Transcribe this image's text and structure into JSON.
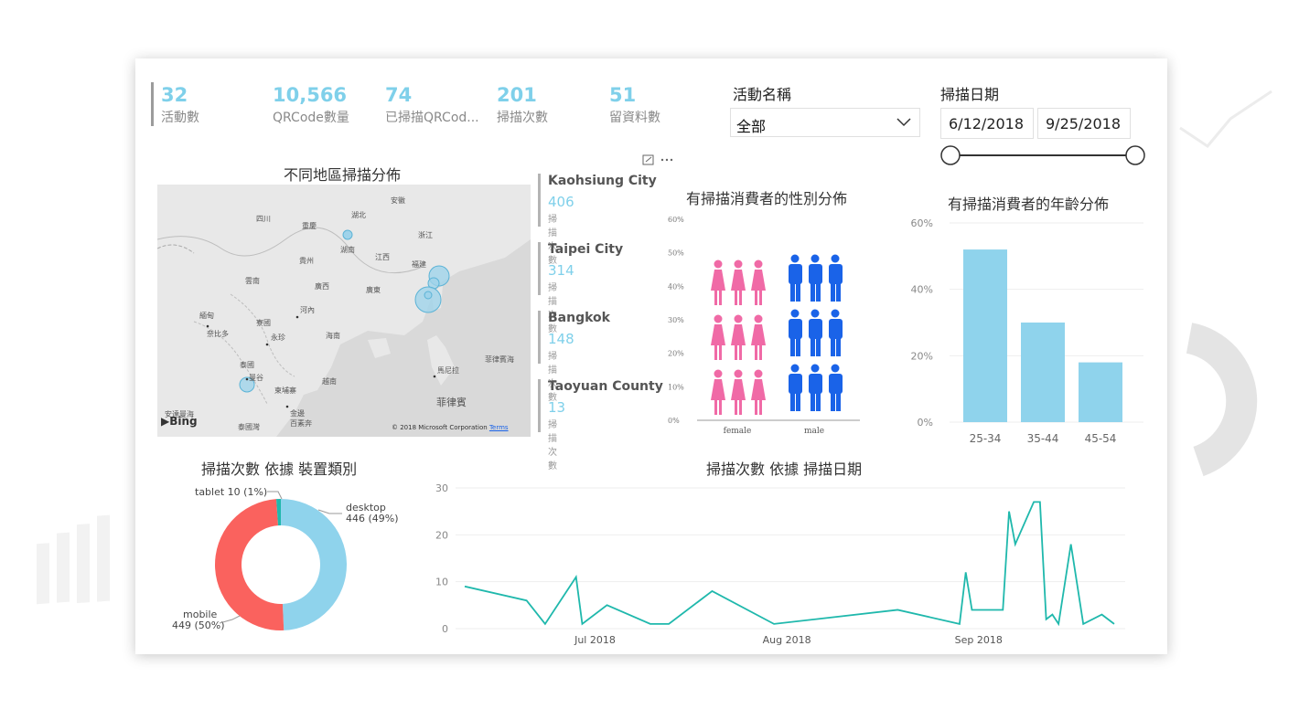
{
  "kpis": [
    {
      "value": "32",
      "label": "活動數"
    },
    {
      "value": "10,566",
      "label": "QRCode數量"
    },
    {
      "value": "74",
      "label": "已掃描QRCod..."
    },
    {
      "value": "201",
      "label": "掃描次數"
    },
    {
      "value": "51",
      "label": "留資料數"
    }
  ],
  "slicers": {
    "activity": {
      "title": "活動名稱",
      "value": "全部"
    },
    "date": {
      "title": "掃描日期",
      "start": "6/12/2018",
      "end": "9/25/2018"
    }
  },
  "map": {
    "title": "不同地區掃描分佈",
    "attribution": "© 2018 Microsoft Corporation",
    "terms": "Terms",
    "bing": "Bing",
    "labels": [
      "四川",
      "湖北",
      "安徽",
      "重慶",
      "湖南",
      "浙江",
      "貴州",
      "江西",
      "福建",
      "雲南",
      "廣西",
      "廣東",
      "緬甸",
      "河內",
      "寮國",
      "奈比多",
      "永珍",
      "海南",
      "泰國",
      "曼谷",
      "越南",
      "柬埔寨",
      "菲律賓海",
      "馬尼拉",
      "菲律賓",
      "金邊",
      "百素奔",
      "安達曼海",
      "泰國灣"
    ]
  },
  "cities": [
    {
      "name": "Kaohsiung City",
      "value": "406",
      "sub": "掃描次數"
    },
    {
      "name": "Taipei City",
      "value": "314",
      "sub": "掃描次數"
    },
    {
      "name": "Bangkok",
      "value": "148",
      "sub": "掃描次數"
    },
    {
      "name": "Taoyuan County",
      "value": "13",
      "sub": "掃描次數"
    }
  ],
  "gender_chart": {
    "title": "有掃描消費者的性別分佈",
    "yticks": [
      "60%",
      "50%",
      "40%",
      "30%",
      "20%",
      "10%",
      "0%"
    ],
    "categories": [
      "female",
      "male"
    ],
    "colors": {
      "female": "#f06aa6",
      "male": "#1a63e8"
    }
  },
  "age_chart": {
    "title": "有掃描消費者的年齡分佈",
    "yticks": [
      "60%",
      "40%",
      "20%",
      "0%"
    ],
    "color": "#8fd3ec"
  },
  "device_chart": {
    "title": "掃描次數 依據 裝置類別",
    "labels": {
      "tablet": "tablet 10 (1%)",
      "desktop_name": "desktop",
      "desktop_val": "446 (49%)",
      "mobile_name": "mobile",
      "mobile_val": "449 (50%)"
    }
  },
  "line_chart": {
    "title": "掃描次數 依據 掃描日期",
    "yticks": [
      "30",
      "20",
      "10",
      "0"
    ],
    "xticks": [
      "Jul 2018",
      "Aug 2018",
      "Sep 2018"
    ],
    "color": "#1fb8ac"
  },
  "chart_data": [
    {
      "type": "bar",
      "title": "有掃描消費者的性別分佈",
      "categories": [
        "female",
        "male"
      ],
      "values": [
        0.48,
        0.52
      ],
      "ylim": [
        0,
        0.6
      ]
    },
    {
      "type": "bar",
      "title": "有掃描消費者的年齡分佈",
      "categories": [
        "25-34",
        "35-44",
        "45-54"
      ],
      "values": [
        0.52,
        0.3,
        0.18
      ],
      "ylim": [
        0,
        0.6
      ]
    },
    {
      "type": "pie",
      "title": "掃描次數 依據 裝置類別",
      "categories": [
        "desktop",
        "mobile",
        "tablet"
      ],
      "values": [
        446,
        449,
        10
      ],
      "colors": [
        "#8fd3ec",
        "#fa625e",
        "#1fb8ac"
      ]
    },
    {
      "type": "line",
      "title": "掃描次數 依據 掃描日期",
      "x": [
        "2018-06-12",
        "2018-06-22",
        "2018-06-25",
        "2018-06-30",
        "2018-07-01",
        "2018-07-05",
        "2018-07-12",
        "2018-07-15",
        "2018-07-22",
        "2018-08-01",
        "2018-08-21",
        "2018-08-31",
        "2018-09-01",
        "2018-09-02",
        "2018-09-07",
        "2018-09-08",
        "2018-09-09",
        "2018-09-12",
        "2018-09-13",
        "2018-09-14",
        "2018-09-15",
        "2018-09-16",
        "2018-09-18",
        "2018-09-20",
        "2018-09-23",
        "2018-09-25"
      ],
      "y": [
        9,
        6,
        1,
        11,
        1,
        5,
        1,
        1,
        8,
        1,
        4,
        1,
        12,
        4,
        4,
        25,
        18,
        27,
        27,
        2,
        3,
        1,
        18,
        1,
        3,
        1
      ],
      "ylim": [
        0,
        30
      ]
    }
  ]
}
